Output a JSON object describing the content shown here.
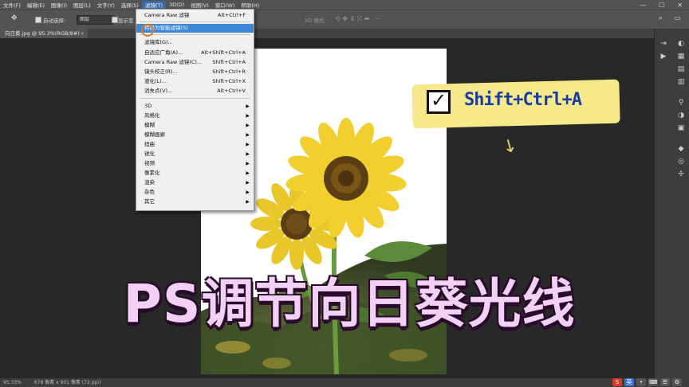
{
  "menubar": {
    "items": [
      "文件(F)",
      "编辑(E)",
      "图像(I)",
      "图层(L)",
      "文字(Y)",
      "选择(S)",
      "滤镜(T)",
      "3D(D)",
      "视图(V)",
      "窗口(W)",
      "帮助(H)"
    ],
    "active_index": 6,
    "window_buttons": [
      "—",
      "☐",
      "✕"
    ]
  },
  "options_bar": {
    "auto_select_label": "自动选择:",
    "auto_select_value": "图层",
    "show_transform_label": "显示变",
    "mode_3d_label": "3D 模式:"
  },
  "document_tab": {
    "title": "向日葵.jpg @ 95.3%(RGB/8#)",
    "close": "×"
  },
  "status_bar": {
    "zoom": "95.33%",
    "doc_info": "678 像素 x 901 像素 (72 ppi)"
  },
  "filter_menu": {
    "items": [
      {
        "label": "Camera Raw 滤镜",
        "shortcut": "Alt+Ctrl+F"
      },
      {
        "label": "转换为智能滤镜(S)",
        "shortcut": "",
        "highlighted": true
      },
      {
        "label": "滤镜库(G)...",
        "shortcut": ""
      },
      {
        "label": "自适应广角(A)...",
        "shortcut": "Alt+Shift+Ctrl+A"
      },
      {
        "label": "Camera Raw 滤镜(C)...",
        "shortcut": "Shift+Ctrl+A"
      },
      {
        "label": "镜头校正(R)...",
        "shortcut": "Shift+Ctrl+R"
      },
      {
        "label": "液化(L)...",
        "shortcut": "Shift+Ctrl+X"
      },
      {
        "label": "消失点(V)...",
        "shortcut": "Alt+Ctrl+V"
      }
    ],
    "submenus": [
      "3D",
      "风格化",
      "模糊",
      "模糊画廊",
      "扭曲",
      "锐化",
      "视频",
      "像素化",
      "渲染",
      "杂色",
      "其它"
    ]
  },
  "shortcut_card": {
    "check": "✓",
    "text": "Shift+Ctrl+A",
    "arrow": "↓"
  },
  "title_overlay": "PS调节向日葵光线",
  "colors": {
    "ps_panel": "#535353",
    "workspace": "#282828",
    "menu_highlight": "#3d87d9",
    "title_fill": "#f3d0f5",
    "card": "#f5e98c",
    "shortcut_text": "#1a3d9c"
  }
}
